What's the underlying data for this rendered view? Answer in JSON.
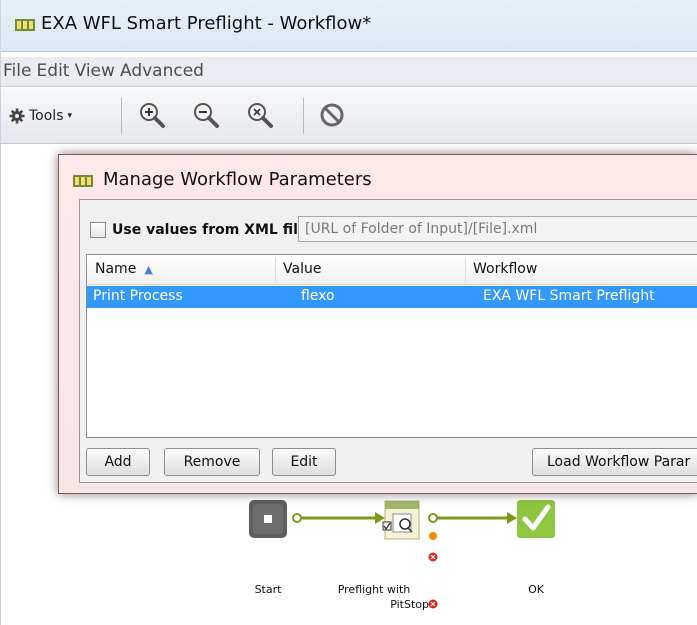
{
  "window": {
    "title": "EXA WFL Smart Preflight  - Workflow*"
  },
  "menu": [
    "File",
    "Edit",
    "View",
    "Advanced"
  ],
  "toolbar": {
    "tools_label": "Tools"
  },
  "dialog": {
    "title": "Manage Workflow Parameters",
    "xml_checkbox_label": "Use values from XML file",
    "xml_path": "[URL of Folder of Input]/[File].xml",
    "columns": [
      "Name",
      "Value",
      "Workflow"
    ],
    "rows": [
      {
        "name": "Print Process",
        "value": "flexo",
        "workflow": "EXA WFL Smart Preflight"
      }
    ],
    "buttons": {
      "add": "Add",
      "remove": "Remove",
      "edit": "Edit",
      "load": "Load Workflow Parar"
    }
  },
  "flow": {
    "nodes": [
      {
        "id": "start",
        "label": "Start"
      },
      {
        "id": "preflight",
        "label_line1": "Preflight with",
        "label_line2": "PitStop"
      },
      {
        "id": "ok",
        "label": "OK"
      }
    ],
    "colors": {
      "connector": "#7a9a1a",
      "ok": "#8ec63f",
      "start": "#5f5f5f",
      "error": "#d9231b",
      "warning": "#f08c00"
    }
  }
}
